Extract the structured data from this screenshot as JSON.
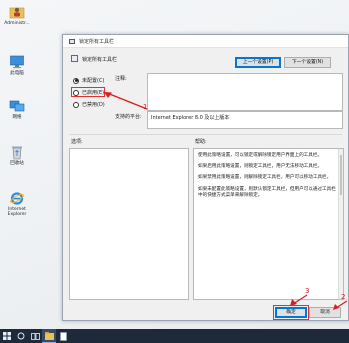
{
  "desktop": {
    "icons": [
      {
        "label": "Administr...",
        "icon": "user-folder-icon"
      },
      {
        "label": "此电脑",
        "icon": "computer-icon"
      },
      {
        "label": "网络",
        "icon": "network-icon"
      },
      {
        "label": "回收站",
        "icon": "recycle-bin-icon"
      },
      {
        "label": "Internet Explorer",
        "icon": "internet-explorer-icon"
      }
    ]
  },
  "dialog": {
    "title": "锁定所有工具栏",
    "policy_name": "锁定所有工具栏",
    "prev_setting_label": "上一个设置(P)",
    "next_setting_label": "下一个设置(N)",
    "options": {
      "not_configured": "未配置(C)",
      "enabled": "已启用(E)",
      "disabled": "已禁用(D)"
    },
    "comment_label": "注释:",
    "supported_label": "支持的平台:",
    "supported_value": "Internet Explorer 8.0 及以上版本",
    "options_label": "选项:",
    "help_label": "帮助:",
    "help_text": [
      "使用此策略设置，可以锁定或解除锁定用户界面上的工具栏。",
      "如果启用此策略设置，则锁定工具栏，用户无法移动工具栏。",
      "如果禁用此策略设置，则解除锁定工具栏，用户可以移动工具栏。",
      "如果未配置此策略设置，则默认锁定工具栏，但用户可以通过工具栏中的快捷方式菜单来解除锁定。"
    ],
    "ok_label": "确定",
    "cancel_label": "取消"
  },
  "annotations": {
    "step1": "1",
    "step2": "2",
    "step3": "3",
    "color": "#d62020"
  },
  "taskbar": {
    "items": [
      "windows-start-icon",
      "search-icon",
      "task-view-icon",
      "file-explorer-icon",
      "document-icon"
    ]
  },
  "colors": {
    "accent": "#0078d7",
    "taskbar": "#1e2a3a",
    "highlight": "#e03030"
  }
}
